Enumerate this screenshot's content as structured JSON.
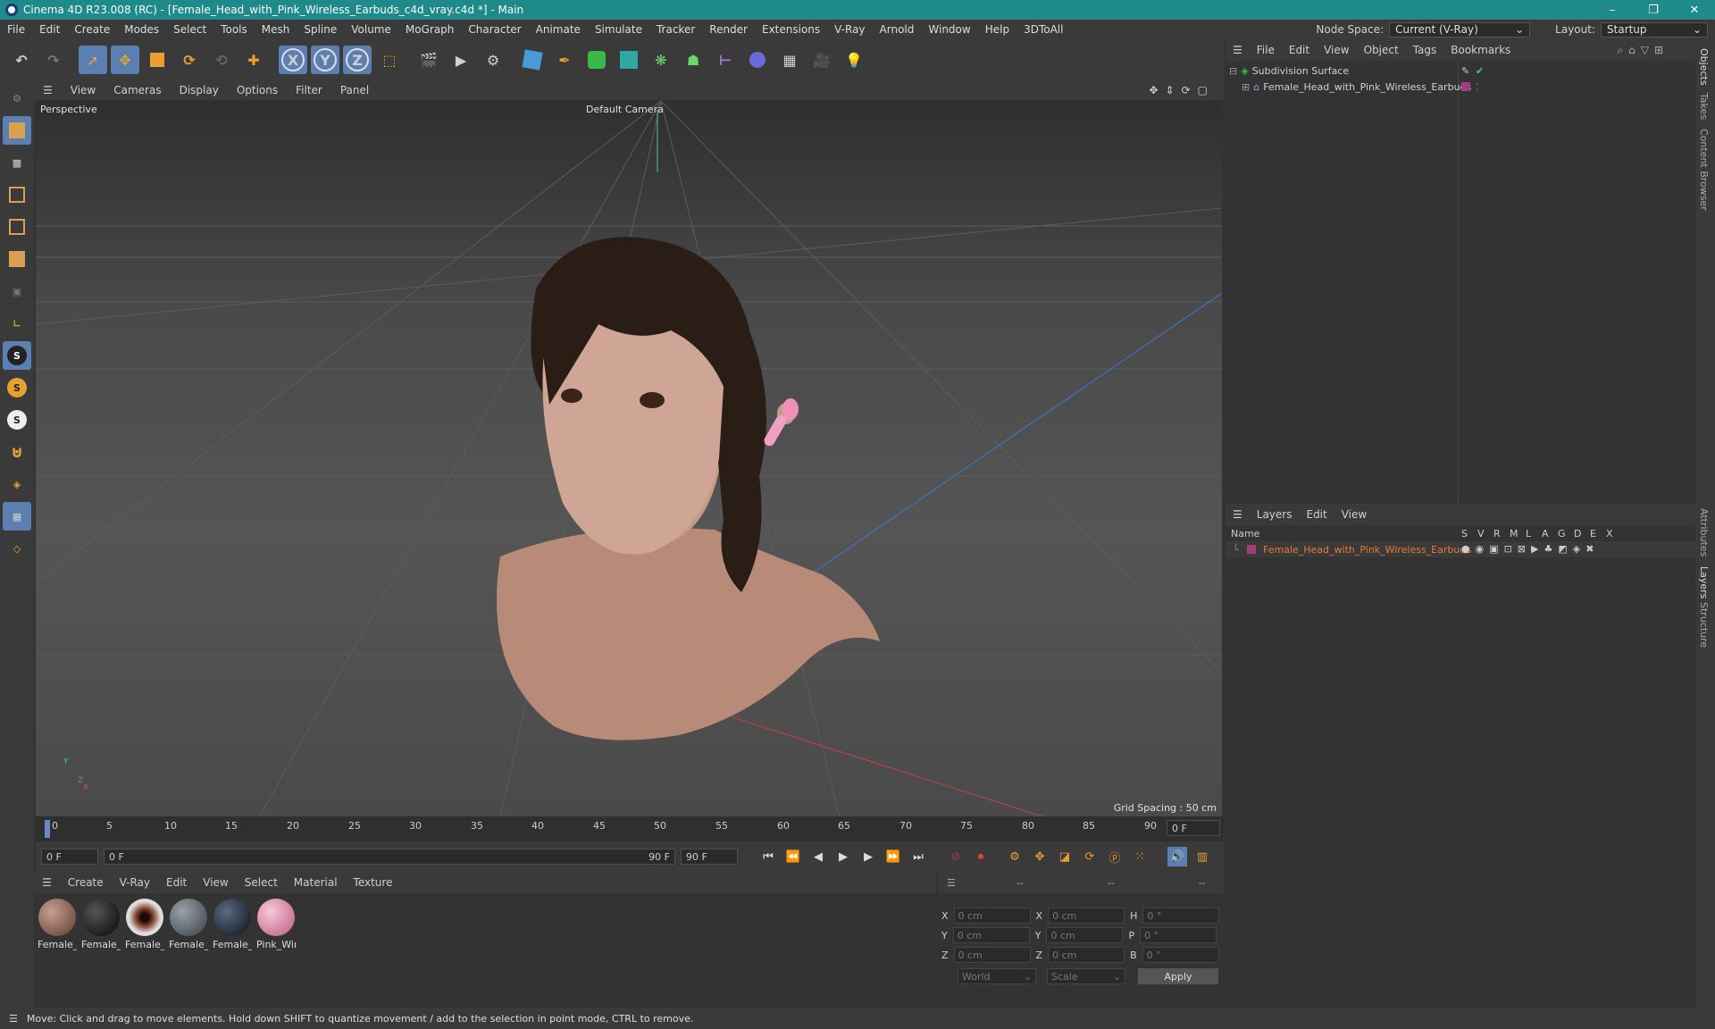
{
  "window": {
    "title": "Cinema 4D R23.008 (RC) - [Female_Head_with_Pink_Wireless_Earbuds_c4d_vray.c4d *] - Main",
    "controls": [
      "–",
      "❐",
      "✕"
    ]
  },
  "menubar": {
    "items": [
      "File",
      "Edit",
      "Create",
      "Modes",
      "Select",
      "Tools",
      "Mesh",
      "Spline",
      "Volume",
      "MoGraph",
      "Character",
      "Animate",
      "Simulate",
      "Tracker",
      "Render",
      "Extensions",
      "V-Ray",
      "Arnold",
      "Window",
      "Help",
      "3DToAll"
    ],
    "node_space_label": "Node Space:",
    "node_space_value": "Current (V-Ray)",
    "layout_label": "Layout:",
    "layout_value": "Startup"
  },
  "toolbar": {
    "axis_x": "X",
    "axis_y": "Y",
    "axis_z": "Z"
  },
  "lefttools": {
    "s1": "S",
    "s2": "S",
    "s3": "S"
  },
  "viewport": {
    "menu": [
      "View",
      "Cameras",
      "Display",
      "Options",
      "Filter",
      "Panel"
    ],
    "mode": "Perspective",
    "camera": "Default Camera",
    "grid_spacing": "Grid Spacing : 50 cm",
    "axis_y": "Y",
    "axis_z": "Z",
    "axis_x": "X"
  },
  "timeline": {
    "ticks": [
      "0",
      "5",
      "10",
      "15",
      "20",
      "25",
      "30",
      "35",
      "40",
      "45",
      "50",
      "55",
      "60",
      "65",
      "70",
      "75",
      "80",
      "85",
      "90"
    ],
    "current_frame": "0 F"
  },
  "transport": {
    "start": "0 F",
    "range_start": "0 F",
    "range_end": "90 F",
    "end": "90 F"
  },
  "materials": {
    "menu": [
      "Create",
      "V-Ray",
      "Edit",
      "View",
      "Select",
      "Material",
      "Texture"
    ],
    "items": [
      {
        "name": "Female_l",
        "color": "#8a6a58"
      },
      {
        "name": "Female_l",
        "color": "#111111"
      },
      {
        "name": "Female_l",
        "color": "#6a3a30"
      },
      {
        "name": "Female_l",
        "color": "#6a6f78"
      },
      {
        "name": "Female_l",
        "color": "#1a2028"
      },
      {
        "name": "Pink_Wir",
        "color": "#e8a0b8"
      }
    ]
  },
  "coordinates": {
    "headers": [
      "--",
      "--",
      "--"
    ],
    "rows": [
      {
        "a": "X",
        "av": "0 cm",
        "b": "X",
        "bv": "0 cm",
        "c": "H",
        "cv": "0 °"
      },
      {
        "a": "Y",
        "av": "0 cm",
        "b": "Y",
        "bv": "0 cm",
        "c": "P",
        "cv": "0 °"
      },
      {
        "a": "Z",
        "av": "0 cm",
        "b": "Z",
        "bv": "0 cm",
        "c": "B",
        "cv": "0 °"
      }
    ],
    "space": "World",
    "mode": "Scale",
    "apply": "Apply"
  },
  "objects": {
    "menu": [
      "File",
      "Edit",
      "View",
      "Object",
      "Tags",
      "Bookmarks"
    ],
    "items": [
      {
        "name": "Subdivision Surface"
      },
      {
        "name": "Female_Head_with_Pink_Wireless_Earbuds"
      }
    ]
  },
  "layers": {
    "menu": [
      "Layers",
      "Edit",
      "View"
    ],
    "columns": [
      "Name",
      "S",
      "V",
      "R",
      "M",
      "L",
      "A",
      "G",
      "D",
      "E",
      "X"
    ],
    "items": [
      {
        "name": "Female_Head_with_Pink_Wireless_Earbuds"
      }
    ]
  },
  "side_tabs": [
    "Objects",
    "Takes",
    "Content Browser",
    "Attributes",
    "Layers",
    "Structure"
  ],
  "status": "Move: Click and drag to move elements. Hold down SHIFT to quantize movement / add to the selection in point mode, CTRL to remove.",
  "colors": {
    "accent": "#1e8a8a",
    "selection": "#5a7fb0",
    "layer": "#a0407a",
    "highlight": "#e87a30"
  }
}
